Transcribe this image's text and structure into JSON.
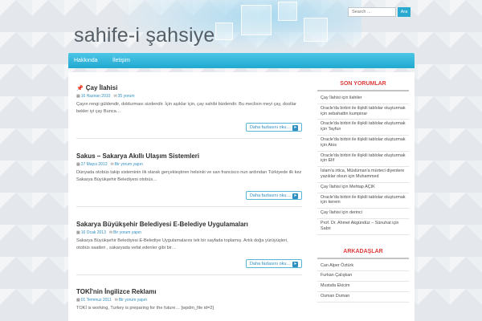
{
  "site": {
    "title": "sahife-i şahsiye"
  },
  "search": {
    "placeholder": "Search ...",
    "button": "Ara"
  },
  "nav": {
    "items": [
      "Hakkında",
      "İletişim"
    ]
  },
  "posts": [
    {
      "title": "Çay İlahisi",
      "pinned": true,
      "date": "16 Haziran 2010",
      "comments": "35 yorum",
      "excerpt": "Çayın rengi güldendir, doldurması sizdendir. İçin aşıklar için, çay sahibi bizdendir. Bu meclisin meyi çay, dostlar bekler iyi çay Bunca…",
      "more": "Daha fazlasını oku…"
    },
    {
      "title": "Sakus – Sakarya Akıllı Ulaşım Sistemleri",
      "pinned": false,
      "date": "27 Mayıs 2013",
      "comments": "Bir yorum yapın",
      "excerpt": "Dünyada otobüs takip sisteminin ilk olarak gerçekleştiren helsinki ve san francisco nun ardından Türkiyede ilk kez Sakarya Büyükşehir Belediyesi otobüs…",
      "more": "Daha fazlasını oku…"
    },
    {
      "title": "Sakarya Büyükşehir Belediyesi E-Belediye Uygulamaları",
      "pinned": false,
      "date": "16 Ocak 2013",
      "comments": "Bir yorum yapın",
      "excerpt": "Sakarya Büyükşehir Belediyesi E-Belediye Uygulamalarını tek bir sayfada toplamış. Artık doğa yürüyüşleri, otobüs saatleri , sakaryada vefat edenler gibi bir…",
      "more": "Daha fazlasını oku…"
    },
    {
      "title": "TOKİ'nin İngilizce Reklamı",
      "pinned": false,
      "date": "01 Temmuz 2011",
      "comments": "Bir yorum yapın",
      "excerpt": "TOKİ is working, Turkey is preparing for the future… [wpdm_file id=2]",
      "more": ""
    }
  ],
  "sidebar": {
    "recent_comments_title": "SON YORUMLAR",
    "recent_comments": [
      "Çay İlahisi için ilahiler",
      "Oracle'da birbiri ile ilişkili tablolar oluşturmak için sebahattin kumpinar",
      "Oracle'da birbiri ile ilişkili tablolar oluşturmak için Tayfun",
      "Oracle'da birbiri ile ilişkili tablolar oluşturmak için Atos",
      "Oracle'da birbiri ile ilişkili tablolar oluşturmak için Elif",
      "İslam'a irtica, Müslüman'a mürteci diyenlere yazıklar olsun için Muhammed",
      "Çay İlahisi için Mehtap AÇIK",
      "Oracle'da birbiri ile ilişkili tablolar oluşturmak için kerem",
      "Çay İlahisi için derinci",
      "Prof. Dr. Ahmet Akgündüz – Sünuhat için Sabri"
    ],
    "friends_title": "ARKADAŞLAR",
    "friends": [
      "Can Alper Öztürk",
      "Furkan Çalışkan",
      "Mustafa Ekicim",
      "Osman Duman"
    ]
  },
  "colors": {
    "accent": "#29a9d0",
    "nav": "#33b7de",
    "sidebar_heading": "#e03b3b",
    "link": "#2f8fc0"
  }
}
